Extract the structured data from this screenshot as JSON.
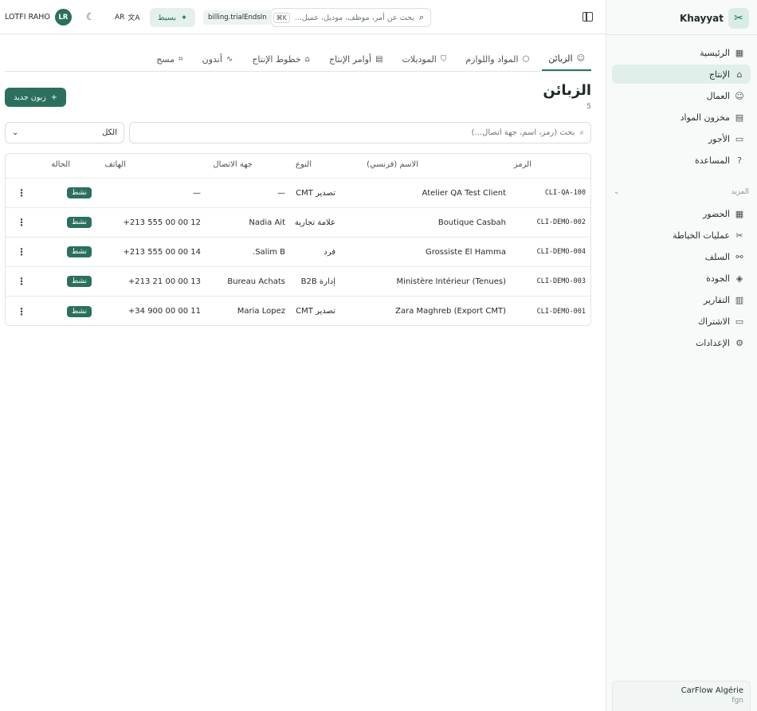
{
  "app": {
    "brand": "Khayyat",
    "footer_title": "CarFlow Algérie",
    "footer_sub": "fgn"
  },
  "sidebar": {
    "items": [
      {
        "label": "الرئيسية",
        "icon": "grid-icon"
      },
      {
        "label": "الإنتاج",
        "icon": "factory-icon",
        "active": true
      },
      {
        "label": "العمال",
        "icon": "users-icon"
      },
      {
        "label": "مخزون المواد",
        "icon": "warehouse-icon"
      },
      {
        "label": "الأجور",
        "icon": "wallet-icon"
      },
      {
        "label": "المساعدة",
        "icon": "help-icon"
      }
    ],
    "more_label": "المزيد",
    "more_items": [
      {
        "label": "الحضور",
        "icon": "calendar-icon"
      },
      {
        "label": "عمليات الخياطة",
        "icon": "scissors-icon"
      },
      {
        "label": "السلف",
        "icon": "advance-icon"
      },
      {
        "label": "الجودة",
        "icon": "shield-icon"
      },
      {
        "label": "التقارير",
        "icon": "chart-icon"
      },
      {
        "label": "الاشتراك",
        "icon": "card-icon"
      },
      {
        "label": "الإعدادات",
        "icon": "gear-icon"
      }
    ]
  },
  "topbar": {
    "search_placeholder": "بحث عن أمر، موظف، موديل، عميل...",
    "shortcut": "K⌘",
    "billing": "billing.trialEndsIn",
    "plan": "بسيط",
    "lang": "AR",
    "user_name": "LOTFI RAHO",
    "user_initials": "LR"
  },
  "tabs": [
    {
      "label": "الزبائن",
      "icon": "users-icon",
      "active": true
    },
    {
      "label": "المواد واللوازم",
      "icon": "box-icon"
    },
    {
      "label": "الموديلات",
      "icon": "shirt-icon"
    },
    {
      "label": "أوامر الإنتاج",
      "icon": "clipboard-icon"
    },
    {
      "label": "خطوط الإنتاج",
      "icon": "factory-icon"
    },
    {
      "label": "أندون",
      "icon": "pulse-icon"
    },
    {
      "label": "مسح",
      "icon": "scan-icon"
    }
  ],
  "page": {
    "title": "الزبائن",
    "count": "5",
    "new_button": "زبون جديد"
  },
  "filters": {
    "search_placeholder": "بحث (رمز، اسم، جهة اتصال...)",
    "select_value": "الكل"
  },
  "table": {
    "headers": {
      "code": "الرمز",
      "name": "الاسم (فرنسي)",
      "type": "النوع",
      "contact": "جهة الاتصال",
      "phone": "الهاتف",
      "status": "الحالة"
    },
    "rows": [
      {
        "code": "CLI-QA-100",
        "name": "Atelier QA Test Client",
        "type": "تصدير CMT",
        "contact": "—",
        "phone": "—",
        "status": "نشط"
      },
      {
        "code": "CLI-DEMO-002",
        "name": "Boutique Casbah",
        "type": "علامة تجارية",
        "contact": "Nadia Ait",
        "phone": "+213 555 00 00 12",
        "status": "نشط"
      },
      {
        "code": "CLI-DEMO-004",
        "name": "Grossiste El Hamma",
        "type": "فرد",
        "contact": "Salim B.",
        "phone": "+213 555 00 00 14",
        "status": "نشط"
      },
      {
        "code": "CLI-DEMO-003",
        "name": "Ministère Intérieur (Tenues)",
        "type": "إدارة B2B",
        "contact": "Bureau Achats",
        "phone": "+213 21 00 00 13",
        "status": "نشط"
      },
      {
        "code": "CLI-DEMO-001",
        "name": "Zara Maghreb (Export CMT)",
        "type": "تصدير CMT",
        "contact": "Maria Lopez",
        "phone": "+34 900 00 00 11",
        "status": "نشط"
      }
    ]
  }
}
